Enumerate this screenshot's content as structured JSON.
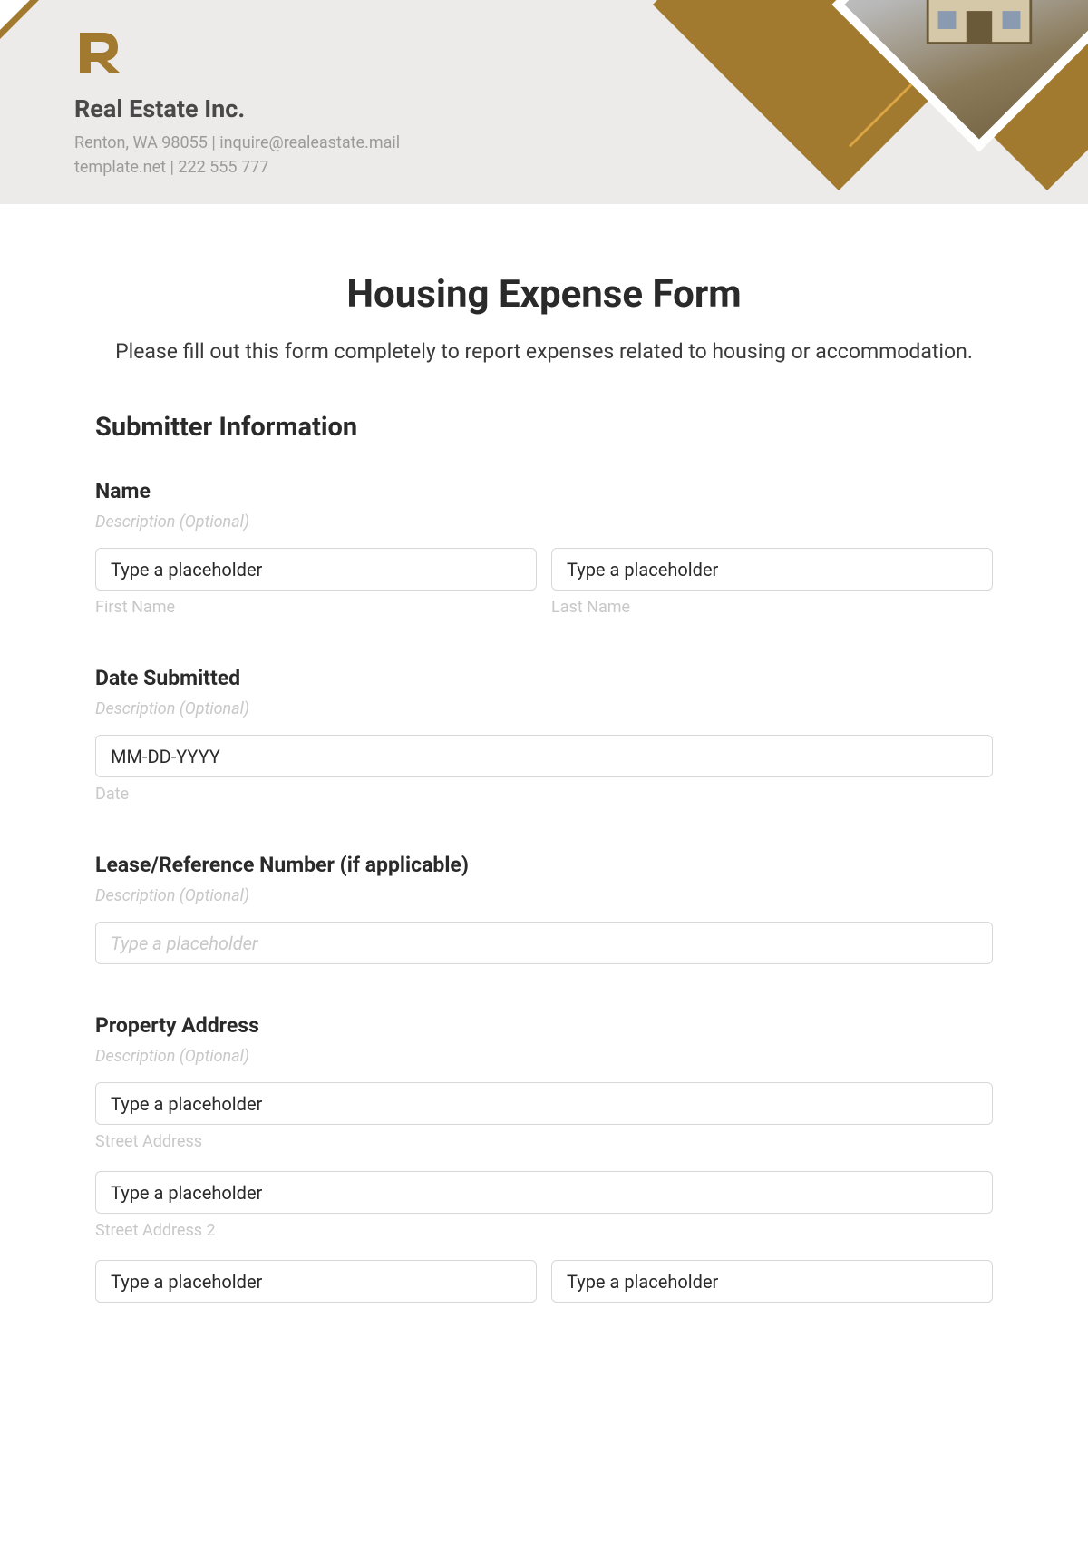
{
  "company": {
    "name": "Real Estate Inc.",
    "line1": "Renton, WA 98055 | inquire@realeastate.mail",
    "line2": "template.net | 222 555 777"
  },
  "form": {
    "title": "Housing Expense Form",
    "subtitle": "Please fill out this form completely to report expenses related to housing or accommodation.",
    "section1": "Submitter Information",
    "desc_optional": "Description (Optional)",
    "name": {
      "label": "Name",
      "first_ph": "Type a placeholder",
      "last_ph": "Type a placeholder",
      "first_sub": "First Name",
      "last_sub": "Last Name"
    },
    "date": {
      "label": "Date Submitted",
      "ph": "MM-DD-YYYY",
      "sub": "Date"
    },
    "lease": {
      "label": "Lease/Reference Number (if applicable)",
      "ph": "Type a placeholder"
    },
    "address": {
      "label": "Property Address",
      "street_ph": "Type a placeholder",
      "street_sub": "Street Address",
      "street2_ph": "Type a placeholder",
      "street2_sub": "Street Address 2",
      "city_ph": "Type a placeholder",
      "state_ph": "Type a placeholder"
    }
  }
}
